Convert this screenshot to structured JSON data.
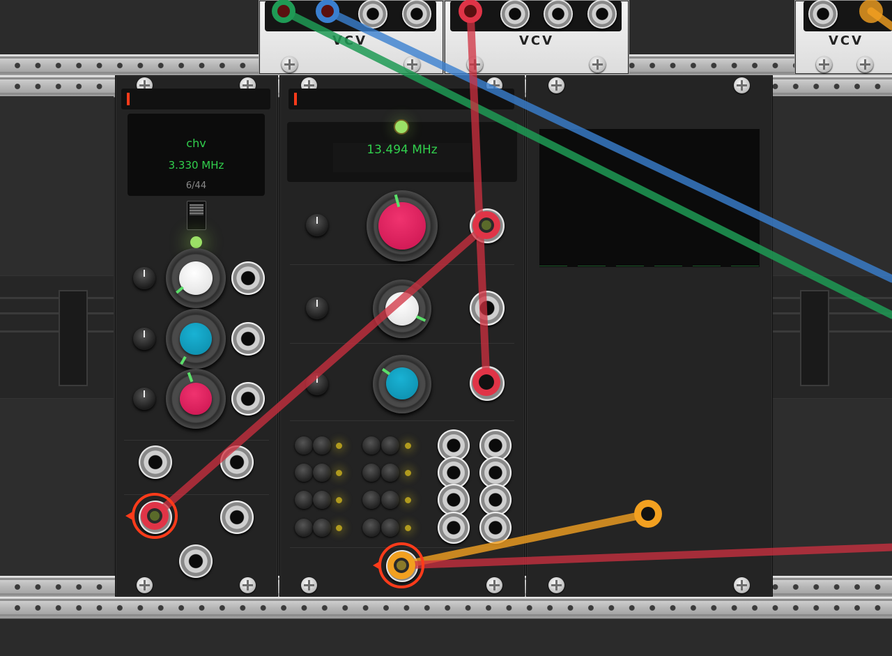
{
  "colors": {
    "cable_red": "#d03040",
    "cable_green": "#1f9a55",
    "cable_blue": "#3a7fd0",
    "cable_orange": "#f2a020",
    "display_green": "#31d04d",
    "knob_pink": "#e01d5e",
    "knob_teal": "#1198b8",
    "knob_white": "#f2f2f2",
    "accent_orange_red": "#ff3b1a"
  },
  "top_modules": [
    {
      "brand": "VCV"
    },
    {
      "brand": "VCV"
    },
    {
      "brand": "VCV"
    }
  ],
  "module_left": {
    "display": {
      "name": "chv",
      "frequency": "3.330 MHz",
      "index": "6/44"
    },
    "knobs": [
      "white-knob",
      "teal-knob",
      "pink-knob"
    ]
  },
  "module_middle": {
    "display": {
      "frequency": "13.494 MHz"
    },
    "knobs": [
      "pink-knob",
      "white-knob",
      "teal-knob"
    ]
  },
  "module_right": {
    "display": {}
  },
  "icons": [
    "screw-icon",
    "jack-icon",
    "knob-icon",
    "led-icon",
    "cable-icon"
  ]
}
